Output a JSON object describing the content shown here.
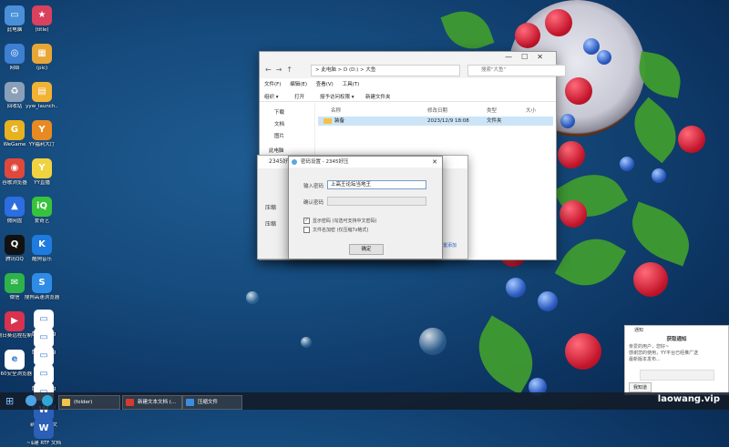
{
  "desktop_icons": [
    {
      "label": "此电脑",
      "color": "#4a90d9",
      "glyph": "▭"
    },
    {
      "label": "网络",
      "color": "#3d7fd0",
      "glyph": "◎"
    },
    {
      "label": "回收站",
      "color": "#8aa0b8",
      "glyph": "♻"
    },
    {
      "label": "WeGame",
      "color": "#e8b120",
      "glyph": "G"
    },
    {
      "label": "谷歌浏览器",
      "color": "#e0483c",
      "glyph": "◉"
    },
    {
      "label": "微网盘",
      "color": "#2c6de0",
      "glyph": "▲"
    },
    {
      "label": "腾讯QQ",
      "color": "#111111",
      "glyph": "Q"
    },
    {
      "label": "微信",
      "color": "#2db34a",
      "glyph": "✉"
    },
    {
      "label": "向日葵远程控制",
      "color": "#d8324e",
      "glyph": "▶"
    },
    {
      "label": "360安全浏览器",
      "color": "#ffffff",
      "glyph": "e"
    },
    {
      "label": "(title)",
      "color": "#d9415e",
      "glyph": "★"
    },
    {
      "label": "(pic)",
      "color": "#e7a636",
      "glyph": "▦"
    },
    {
      "label": "yyw_launch..",
      "color": "#f2b233",
      "glyph": "▤"
    },
    {
      "label": "YY福利大厅",
      "color": "#e88a22",
      "glyph": "Y"
    },
    {
      "label": "YY直播",
      "color": "#f1d240",
      "glyph": "Y"
    },
    {
      "label": "爱奇艺",
      "color": "#37c33b",
      "glyph": "iQ"
    },
    {
      "label": "酷狗音乐",
      "color": "#1f7be0",
      "glyph": "K"
    },
    {
      "label": "搜狗高速浏览器",
      "color": "#2f8ce6",
      "glyph": "S"
    },
    {
      "label": "图片3.png",
      "color": "#ffffff",
      "glyph": "▭"
    },
    {
      "label": "图片4.png",
      "color": "#ffffff",
      "glyph": "▭"
    },
    {
      "label": "图片1",
      "color": "#ffffff",
      "glyph": "▭"
    },
    {
      "label": "图片5.png",
      "color": "#ffffff",
      "glyph": "▭"
    },
    {
      "label": "图片7.png",
      "color": "#ffffff",
      "glyph": "▭"
    },
    {
      "label": "新建 RTF 文档.rtf",
      "color": "#2b5fb8",
      "glyph": "W"
    },
    {
      "label": "~$建 RTF 文档",
      "color": "#2b5fb8",
      "glyph": "W"
    }
  ],
  "explorer": {
    "address": "> 此电脑 > D (D:) > 大鱼",
    "search_placeholder": "搜索\"大鱼\"",
    "menu": [
      "文件(F)",
      "编辑(E)",
      "查看(V)",
      "工具(T)"
    ],
    "toolbar": {
      "organize": "组织 ▾",
      "open": "打开",
      "share": "授予访问权限 ▾",
      "new_folder": "新建文件夹"
    },
    "sidebar": [
      "下载",
      "文档",
      "图片",
      "此电脑"
    ],
    "columns": {
      "name": "名称",
      "modified": "修改日期",
      "type": "类型",
      "size": "大小"
    },
    "rows": [
      {
        "name": "装备",
        "modified": "2023/12/9 18:08",
        "type": "文件夹"
      }
    ]
  },
  "compressor": {
    "title": "2345好压",
    "label_a": "压缩",
    "label_b": "压缩",
    "link": "配置添加"
  },
  "dialog": {
    "title": "密码设置 - 2345好压",
    "enter_label": "输入密码",
    "enter_value": "上高王论坛当地王",
    "confirm_label": "确认密码",
    "confirm_value": "",
    "show_password": "显示密码 (勾选可支持中文密码)",
    "encrypt_names": "文件名加密 (仅压缩7z格式)",
    "ok": "确定"
  },
  "notification": {
    "app": "通知",
    "title": "获取通知",
    "lines": [
      "亲爱的用户，您好~",
      "感谢您的使用，YY平台已经推广送",
      "最新版本发布..."
    ],
    "button": "我知道"
  },
  "taskbar": [
    {
      "label": "(folder)",
      "color": "#f3c24a"
    },
    {
      "label": "新建文本文档 (...",
      "color": "#d83a2e"
    },
    {
      "label": "压缩文件",
      "color": "#3a8ee0"
    }
  ],
  "watermark": "laowang.vip"
}
